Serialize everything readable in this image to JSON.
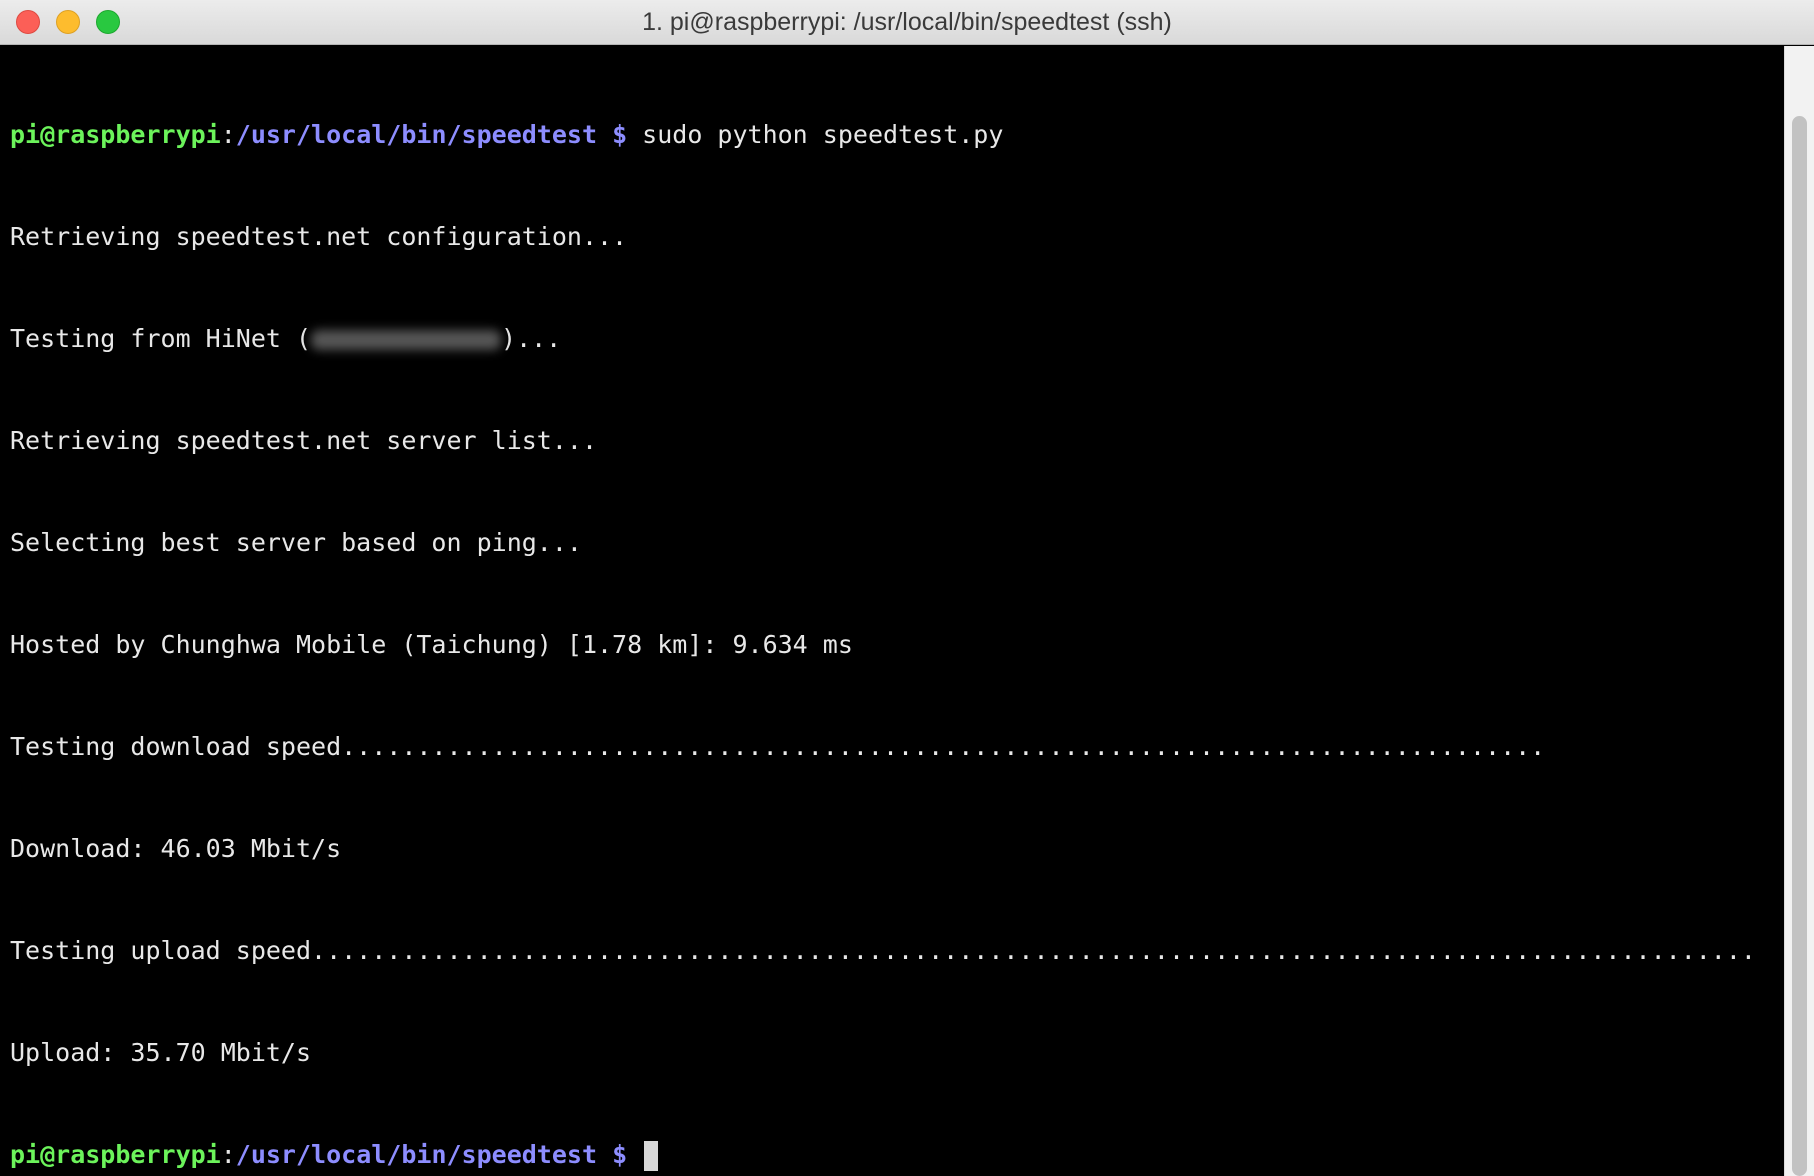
{
  "window": {
    "title": "1. pi@raspberrypi: /usr/local/bin/speedtest (ssh)"
  },
  "prompt": {
    "user_host": "pi@raspberrypi",
    "sep": ":",
    "path": "/usr/local/bin/speedtest",
    "dollar": " $ "
  },
  "terminal": {
    "command": "sudo python speedtest.py",
    "line_config": "Retrieving speedtest.net configuration...",
    "line_testing_from_prefix": "Testing from HiNet (",
    "line_testing_from_suffix": ")...",
    "line_server_list": "Retrieving speedtest.net server list...",
    "line_selecting": "Selecting best server based on ping...",
    "line_hosted": "Hosted by Chunghwa Mobile (Taichung) [1.78 km]: 9.634 ms",
    "line_testing_download": "Testing download speed................................................................................",
    "line_download": "Download: 46.03 Mbit/s",
    "line_testing_upload": "Testing upload speed................................................................................................",
    "line_upload": "Upload: 35.70 Mbit/s"
  },
  "colors": {
    "user_host": "#6cf35b",
    "path": "#8d8dff",
    "text": "#e8e8e8",
    "background": "#000000"
  }
}
